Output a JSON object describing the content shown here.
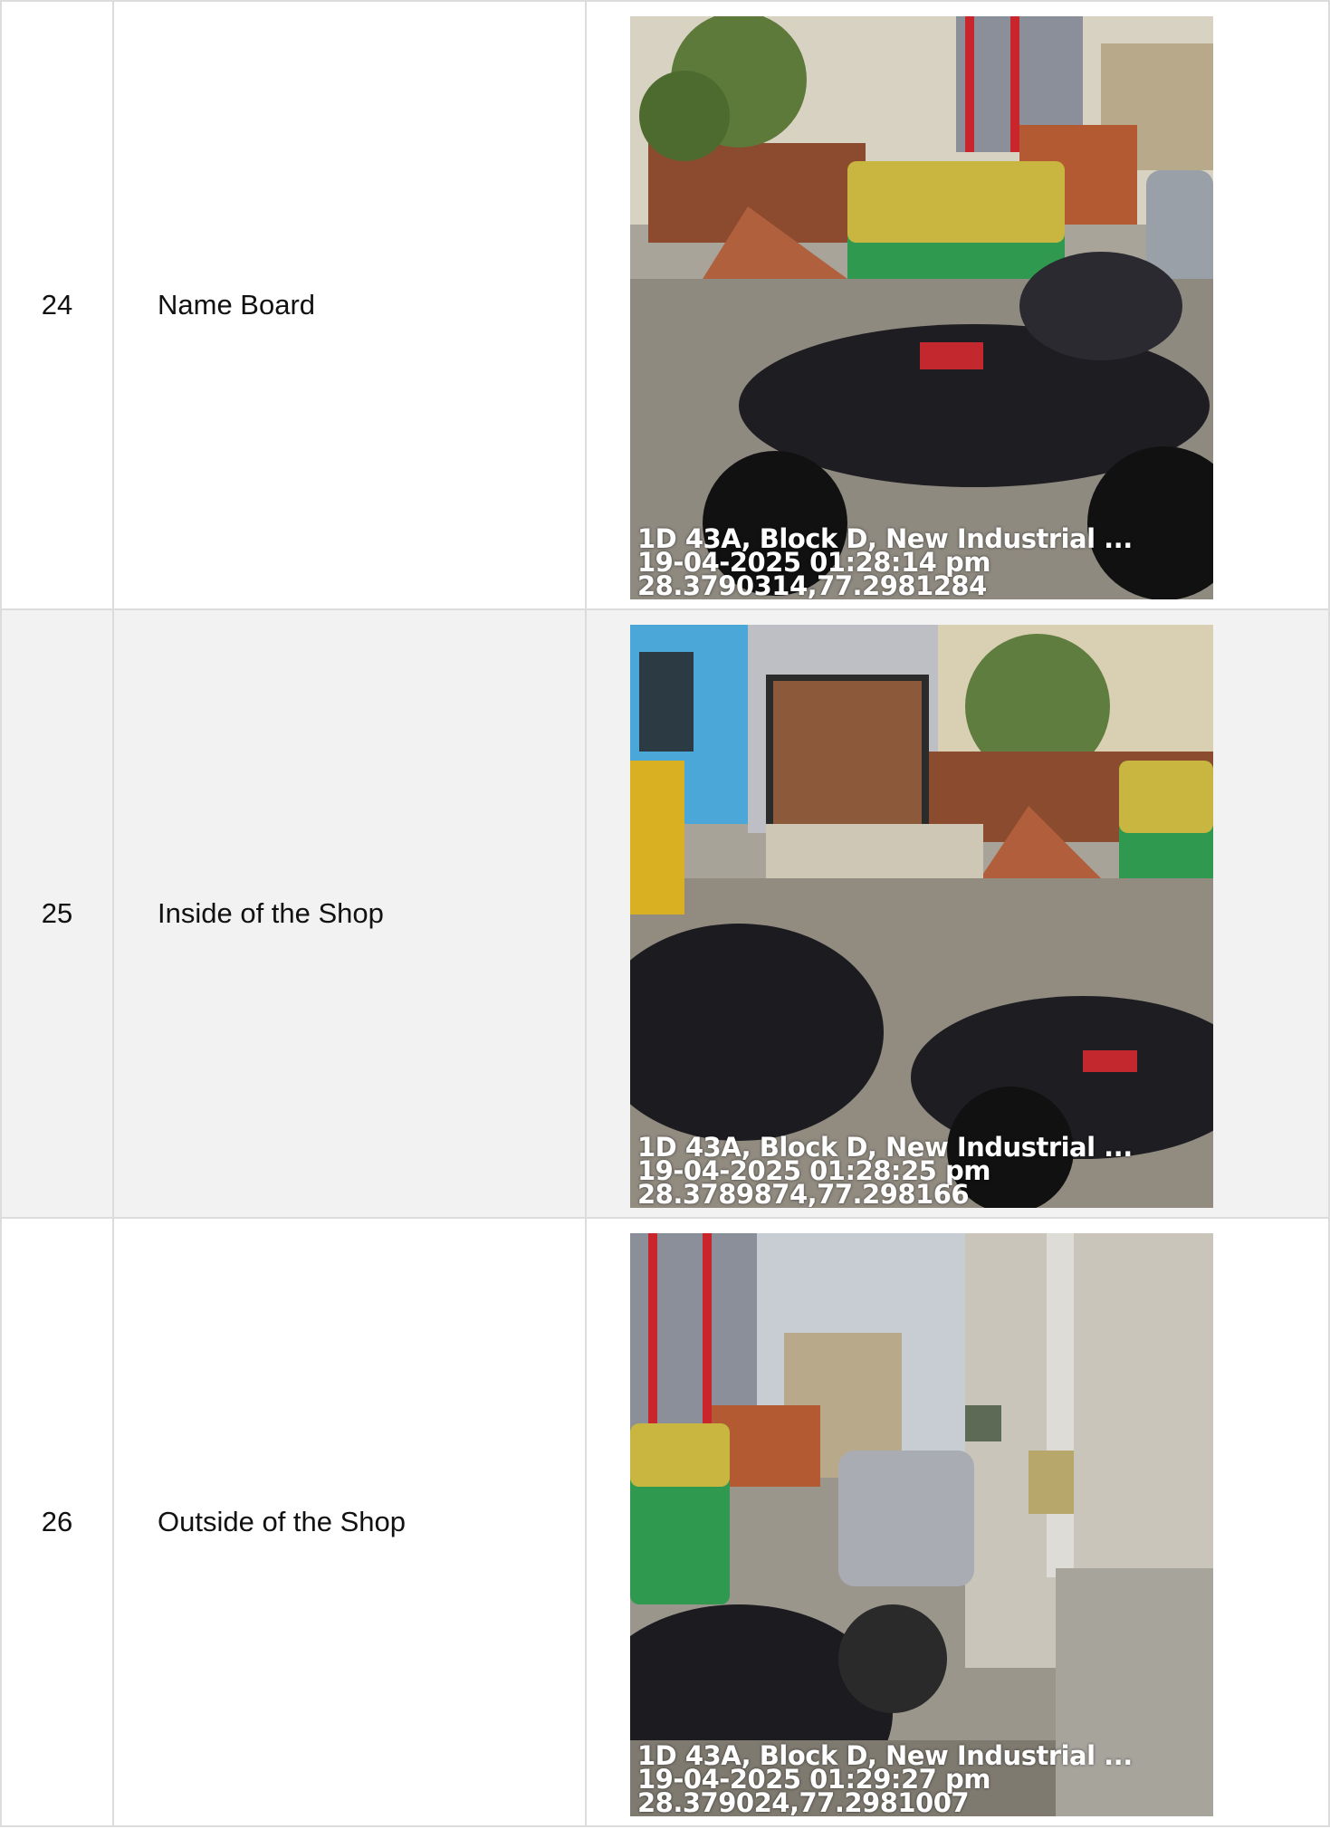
{
  "rows": [
    {
      "number": "24",
      "label": "Name Board",
      "photo": {
        "caption_line1": "1D 43A, Block D, New Industrial ...",
        "caption_line2": "19-04-2025 01:28:14 pm",
        "caption_line3": "28.3790314,77.2981284"
      }
    },
    {
      "number": "25",
      "label": "Inside of the Shop",
      "photo": {
        "caption_line1": "1D 43A, Block D, New Industrial ...",
        "caption_line2": "19-04-2025 01:28:25 pm",
        "caption_line3": "28.3789874,77.298166"
      }
    },
    {
      "number": "26",
      "label": "Outside of the Shop",
      "photo": {
        "caption_line1": "1D 43A, Block D, New Industrial ...",
        "caption_line2": "19-04-2025 01:29:27 pm",
        "caption_line3": "28.379024,77.2981007"
      }
    }
  ]
}
